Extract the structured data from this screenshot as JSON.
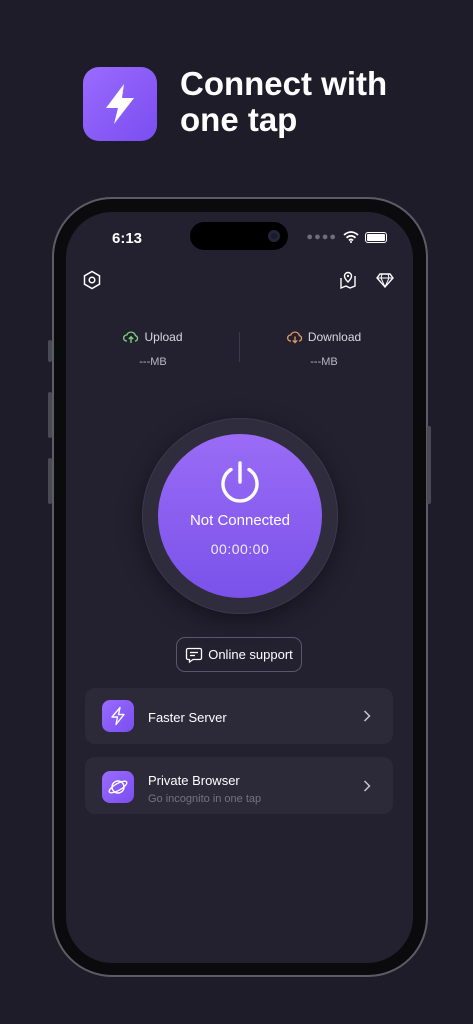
{
  "hero": {
    "title": "Connect with\none tap",
    "icon": "lightning-bolt-icon"
  },
  "status_bar": {
    "time": "6:13",
    "icons": [
      "cellular-dots-icon",
      "wifi-icon",
      "battery-icon"
    ]
  },
  "toolbar": {
    "left_icon": "settings-hexagon-icon",
    "right_icons": [
      "location-map-icon",
      "diamond-premium-icon"
    ]
  },
  "stats": {
    "upload": {
      "label": "Upload",
      "value": "---MB",
      "icon": "cloud-upload-icon",
      "color": "#7ed67a"
    },
    "download": {
      "label": "Download",
      "value": "---MB",
      "icon": "cloud-download-icon",
      "color": "#e39a64"
    }
  },
  "connection": {
    "status": "Not Connected",
    "timer": "00:00:00",
    "icon": "power-icon"
  },
  "support": {
    "label": "Online support",
    "icon": "chat-bubble-icon"
  },
  "cards": [
    {
      "title": "Faster Server",
      "subtitle": "",
      "icon": "lightning-bolt-icon"
    },
    {
      "title": "Private Browser",
      "subtitle": "Go incognito in one tap",
      "icon": "planet-icon"
    }
  ],
  "colors": {
    "accent": "#8a5cf6",
    "background": "#1e1c28",
    "screen": "#232130",
    "card": "#2c2a38"
  }
}
